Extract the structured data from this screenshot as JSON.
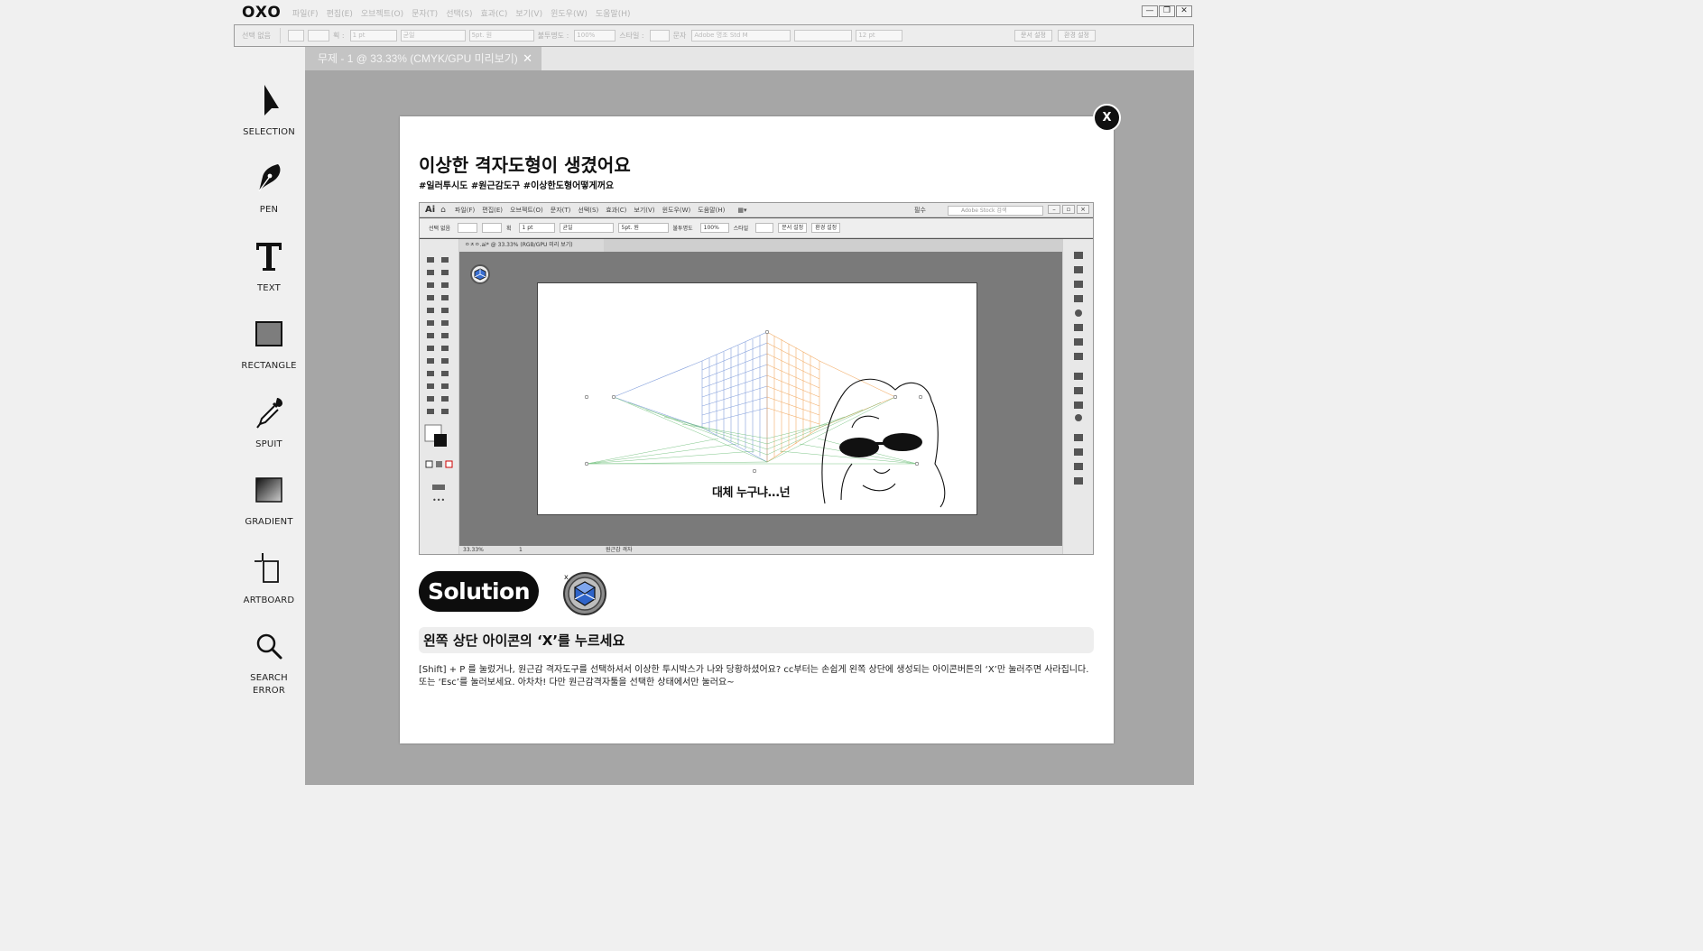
{
  "app": {
    "logo": "OXO",
    "menu": [
      "파일(F)",
      "편집(E)",
      "오브젝트(O)",
      "문자(T)",
      "선택(S)",
      "효과(C)",
      "보기(V)",
      "윈도우(W)",
      "도움말(H)"
    ],
    "window_controls": [
      "—",
      "❐",
      "✕"
    ]
  },
  "options_bar": {
    "no_selection": "선택 없음",
    "stroke_label": "획 :",
    "stroke_value": "1 pt",
    "stroke_style": "균일",
    "brush": "5pt. 원",
    "opacity_label": "불투명도 :",
    "opacity_value": "100%",
    "style_label": "스타일 :",
    "char_label": "문자",
    "font": "Adobe 명조 Std M",
    "font_size": "12 pt",
    "doc_setup": "문서 설정",
    "prefs": "환경 설정"
  },
  "document_tab": {
    "title": "무제 - 1 @ 33.33% (CMYK/GPU 미리보기)",
    "close": "✕"
  },
  "tools": [
    {
      "label": "SELECTION",
      "icon": "selection-arrow-icon"
    },
    {
      "label": "PEN",
      "icon": "pen-nib-icon"
    },
    {
      "label": "TEXT",
      "icon": "text-t-icon"
    },
    {
      "label": "RECTANGLE",
      "icon": "rectangle-icon"
    },
    {
      "label": "SPUIT",
      "icon": "eyedropper-icon"
    },
    {
      "label": "GRADIENT",
      "icon": "gradient-swatch-icon"
    },
    {
      "label": "ARTBOARD",
      "icon": "artboard-crop-icon"
    },
    {
      "label": "SEARCH\nERROR",
      "icon": "magnifier-icon"
    }
  ],
  "modal": {
    "close": "X",
    "title": "이상한 격자도형이 생겼어요",
    "tags": "#일러투시도 #원근감도구 #이상한도형어떻게꺼요",
    "screenshot": {
      "ai_logo": "Ai",
      "menu": [
        "파일(F)",
        "편집(E)",
        "오브젝트(O)",
        "문자(T)",
        "선택(S)",
        "효과(C)",
        "보기(V)",
        "윈도우(W)",
        "도움말(H)"
      ],
      "workspace": "필수",
      "search_placeholder": "Adobe Stock 검색",
      "options": {
        "no_selection": "선택 없음",
        "stroke": "획",
        "stroke_value": "1 pt",
        "uniform": "균일",
        "brush": "5pt. 원",
        "opacity": "불투명도",
        "opacity_value": "100%",
        "style": "스타일",
        "doc_setup": "문서 설정",
        "prefs": "환경 설정"
      },
      "doc_tab": "ㅇㅈㅇ.ai* @ 33.33% (RGB/GPU 미리 보기)",
      "status_zoom": "33.33%",
      "status_page": "1",
      "status_tool": "원근감 격자",
      "meme_caption": "대체 누구냐...넌"
    },
    "solution_label": "Solution",
    "subhead": "왼쪽 상단 아이콘의 ‘X’를 누르세요",
    "body": "[Shift] + P 를 눌렀거나, 원근감 격자도구를 선택하셔서 이상한 투시박스가 나와 당황하셨어요? cc부터는 손쉽게 왼쪽 상단에 생성되는 아이콘버튼의 ‘X’만 눌러주면 사라집니다. 또는 ‘Esc’를 눌러보세요. 아차차! 다만 원근감격자툴을 선택한 상태에서만 눌러요~"
  },
  "colors": {
    "canvas": "#a6a6a6",
    "pill": "#0d0d0d",
    "subhead_bg": "#eeeeee",
    "grid_blue": "#6f8fd6",
    "grid_orange": "#f0a050",
    "grid_green": "#5fb86b"
  }
}
